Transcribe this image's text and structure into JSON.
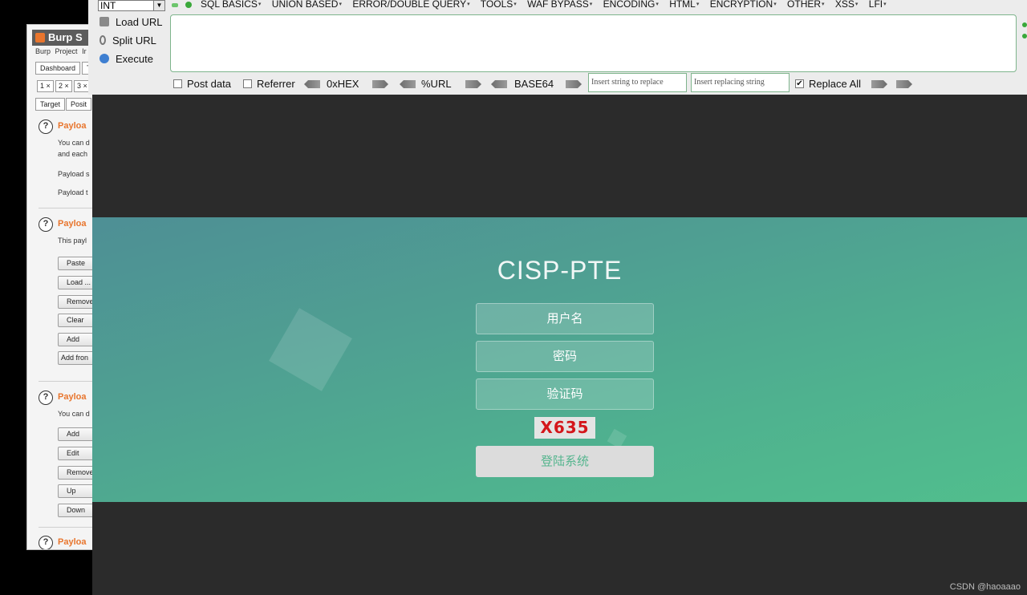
{
  "burp": {
    "title": "Burp S",
    "menu": [
      "Burp",
      "Project",
      "Ir"
    ],
    "top_tabs": [
      "Dashboard",
      "T"
    ],
    "number_tabs": [
      "1",
      "2",
      "3"
    ],
    "sub_tabs": [
      "Target",
      "Posit"
    ],
    "sections": [
      {
        "title": "Payloa",
        "texts": [
          "You can d",
          "and each",
          "Payload s",
          "Payload t"
        ]
      },
      {
        "title": "Payloa",
        "texts": [
          "This payl"
        ],
        "buttons": [
          "Paste",
          "Load ...",
          "Remove",
          "Clear",
          "Add",
          "Add fron"
        ]
      },
      {
        "title": "Payloa",
        "texts": [
          "You can d"
        ],
        "buttons": [
          "Add",
          "Edit",
          "Remove",
          "Up",
          "Down"
        ]
      },
      {
        "title": "Payloa"
      }
    ],
    "help_icon": "?"
  },
  "hackbar": {
    "select_value": "INT",
    "menus": [
      "SQL BASICS",
      "UNION BASED",
      "ERROR/DOUBLE QUERY",
      "TOOLS",
      "WAF BYPASS",
      "ENCODING",
      "HTML",
      "ENCRYPTION",
      "OTHER",
      "XSS",
      "LFI"
    ],
    "commands": {
      "load_url": "Load URL",
      "split_url": "Split URL",
      "execute": "Execute"
    },
    "url_value": "",
    "options": {
      "post_data": "Post data",
      "post_data_checked": false,
      "referrer": "Referrer",
      "referrer_checked": false,
      "hex": "0xHEX",
      "url": "%URL",
      "base64": "BASE64",
      "replace_placeholder": "Insert string to replace",
      "replacing_placeholder": "Insert replacing string",
      "replace_all": "Replace All",
      "replace_all_checked": true,
      "check_mark": "✔"
    }
  },
  "login": {
    "title": "CISP-PTE",
    "username_placeholder": "用户名",
    "password_placeholder": "密码",
    "captcha_placeholder": "验证码",
    "captcha_text": "X635",
    "submit_label": "登陆系统"
  },
  "watermark": "CSDN @haoaaao",
  "colors": {
    "burp_accent": "#e8752d",
    "hero_start": "#4e8f95",
    "hero_end": "#51be8d",
    "captcha": "#d4161b",
    "button_text": "#55b58e"
  }
}
